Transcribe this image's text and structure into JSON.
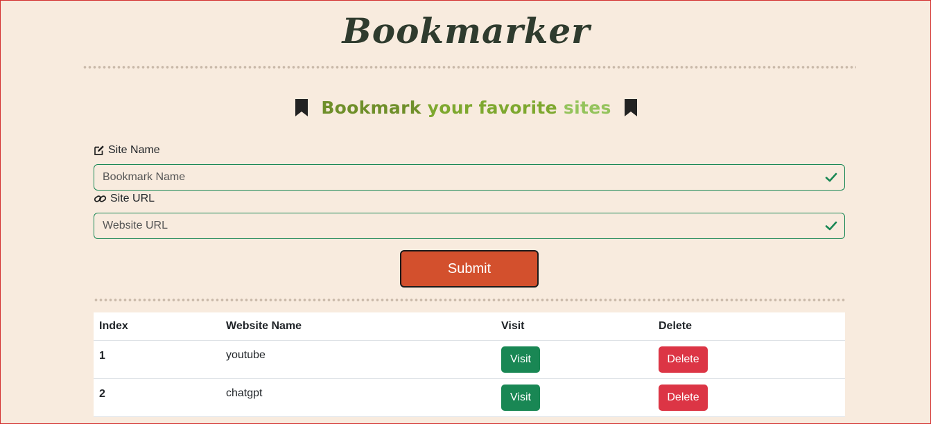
{
  "header": {
    "brand": "Bookmarker"
  },
  "subtitle": {
    "word1": "Bookmark",
    "word2": "your favorite",
    "word3": "sites"
  },
  "form": {
    "site_name_label": "Site Name",
    "site_name_placeholder": "Bookmark Name",
    "site_url_label": "Site URL",
    "site_url_placeholder": "Website URL",
    "submit_label": "Submit"
  },
  "table": {
    "headers": [
      "Index",
      "Website Name",
      "Visit",
      "Delete"
    ],
    "rows": [
      {
        "index": "1",
        "name": "youtube",
        "visit": "Visit",
        "delete": "Delete"
      },
      {
        "index": "2",
        "name": "chatgpt",
        "visit": "Visit",
        "delete": "Delete"
      }
    ]
  },
  "colors": {
    "accent": "#d3502d",
    "success": "#198754",
    "danger": "#dc3545",
    "background": "#f8ebde"
  },
  "icons": [
    "bookmark-icon",
    "edit-icon",
    "link-icon",
    "check-icon"
  ]
}
